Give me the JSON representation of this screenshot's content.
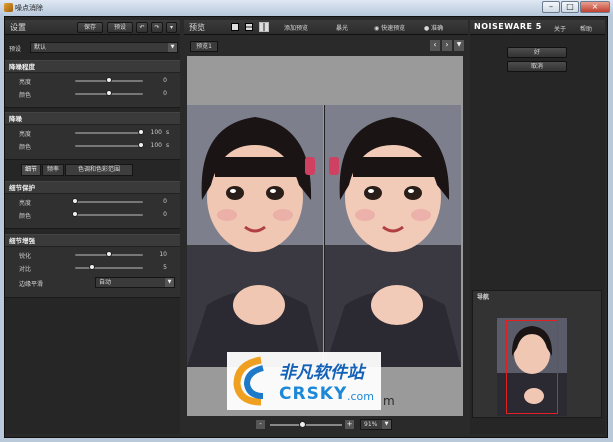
{
  "window": {
    "title": "噪点消除",
    "min": "–",
    "max": "□",
    "close": "×"
  },
  "left": {
    "title": "设置",
    "save": "保存",
    "preset": "预设",
    "undo_icon": "↶",
    "redo_icon": "↷",
    "menu_icon": "▾",
    "preset_label": "预设",
    "preset_value": "默认",
    "s1": {
      "title": "降噪程度",
      "rows": [
        {
          "label": "亮度",
          "value": "0",
          "pos": 0.5
        },
        {
          "label": "颜色",
          "value": "0",
          "pos": 0.5
        }
      ]
    },
    "s2": {
      "title": "降噪",
      "rows": [
        {
          "label": "亮度",
          "value": "100",
          "unit": "s",
          "pos": 0.97
        },
        {
          "label": "颜色",
          "value": "100",
          "unit": "s",
          "pos": 0.97
        }
      ]
    },
    "tabs": [
      "细节",
      "频率",
      "色调和色彩范围"
    ],
    "s3": {
      "title": "细节保护",
      "rows": [
        {
          "label": "亮度",
          "value": "0",
          "pos": 0.0
        },
        {
          "label": "颜色",
          "value": "0",
          "pos": 0.0
        }
      ]
    },
    "s4": {
      "title": "细节增强",
      "rows": [
        {
          "label": "锐化",
          "value": "10",
          "pos": 0.5
        },
        {
          "label": "对比",
          "value": "5",
          "pos": 0.25
        }
      ],
      "edge_label": "边缘平滑",
      "edge_value": "自动"
    }
  },
  "center": {
    "title": "预览",
    "add_preset": "添加预览",
    "exposure": "暴光",
    "fast": "快速预览",
    "accurate": "准确",
    "tab": "预览1",
    "prev": "‹",
    "next": "›",
    "zoom": "91%",
    "minus": "-",
    "plus": "+"
  },
  "right": {
    "brand": "NOISEWARE 5",
    "about": "关于",
    "help": "帮助",
    "ok": "好",
    "cancel": "取消",
    "nav": "导航"
  },
  "watermark": {
    "line1": "非凡软件站",
    "line2": "CRSKY",
    "line3": ".com",
    "tail": "m"
  }
}
